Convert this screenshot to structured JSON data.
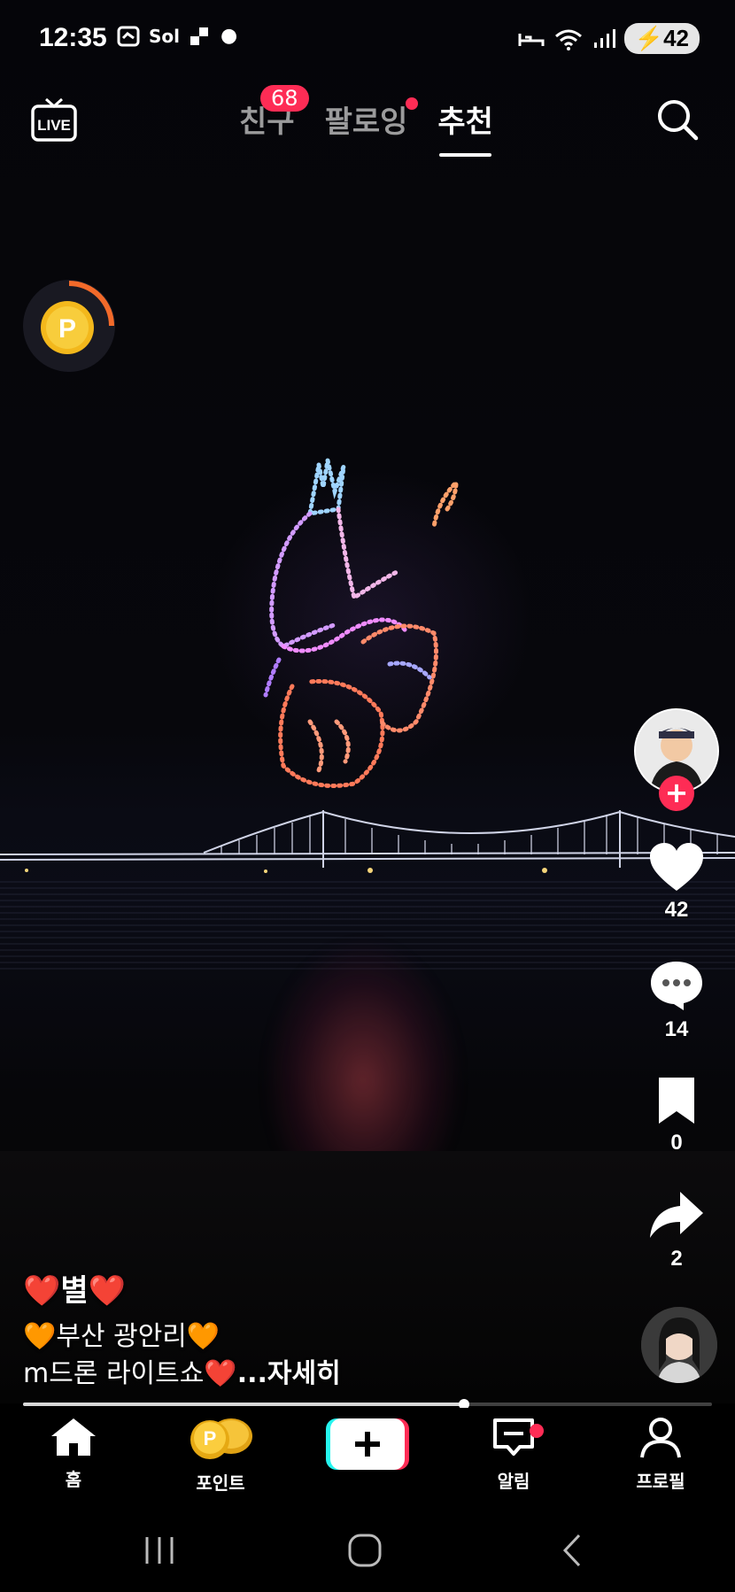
{
  "status_bar": {
    "time": "12:35",
    "left_icons": [
      "notification-icon",
      "sol-bank-icon",
      "app-icon",
      "dot-icon"
    ],
    "right_icons": [
      "sleep-icon",
      "wifi-5g-icon",
      "signal-icon"
    ],
    "battery": "42"
  },
  "top_nav": {
    "live_label": "LIVE",
    "tabs": [
      {
        "label": "친구",
        "badge": "68",
        "active": false
      },
      {
        "label": "팔로잉",
        "dot": true,
        "active": false
      },
      {
        "label": "추천",
        "active": true
      }
    ]
  },
  "actions": {
    "like_count": "42",
    "comment_count": "14",
    "bookmark_count": "0",
    "share_count": "2"
  },
  "caption": {
    "author": "❤️별❤️",
    "line1": "🧡부산 광안리🧡",
    "line2": "m드론 라이트쇼❤️",
    "more": "...자세히"
  },
  "progress": 0.64,
  "bottom_nav": {
    "items": [
      {
        "label": "홈",
        "icon": "home-icon"
      },
      {
        "label": "포인트",
        "icon": "coins-icon"
      },
      {
        "label": "",
        "icon": "create-plus-icon"
      },
      {
        "label": "알림",
        "icon": "inbox-icon"
      },
      {
        "label": "프로필",
        "icon": "profile-icon"
      }
    ]
  },
  "colors": {
    "accent": "#fe2c55",
    "background": "#000000"
  }
}
